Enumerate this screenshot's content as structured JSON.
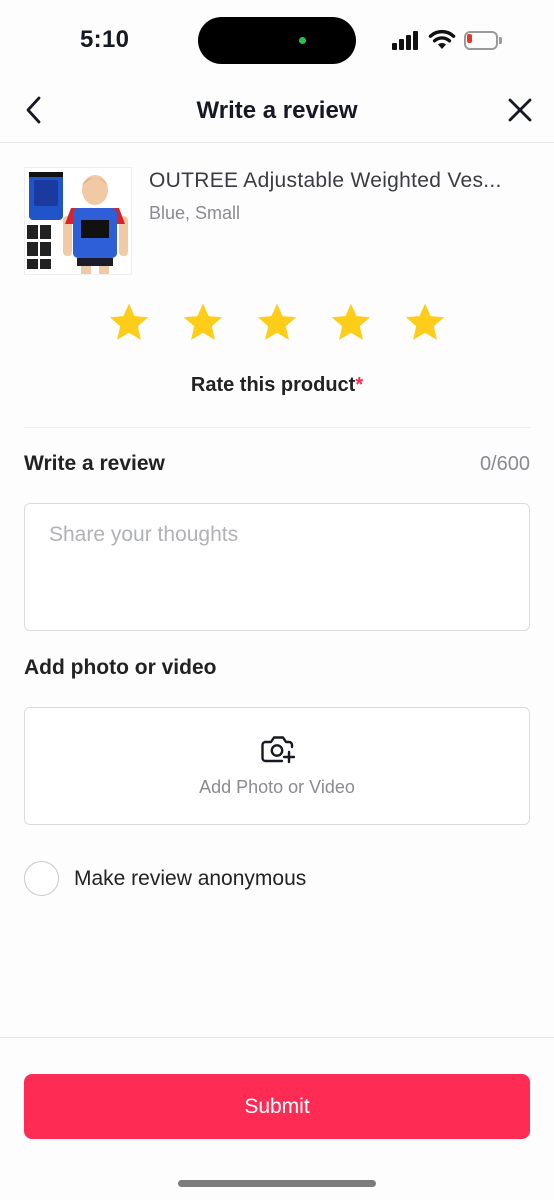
{
  "status_bar": {
    "time": "5:10",
    "icons": [
      "signal-icon",
      "wifi-icon",
      "battery-low-icon"
    ],
    "battery_color": "#e5372c"
  },
  "header": {
    "title": "Write a review",
    "back_icon": "chevron-left-icon",
    "close_icon": "close-icon"
  },
  "product": {
    "name": "OUTREE Adjustable Weighted Ves...",
    "variant": "Blue, Small",
    "image_icon": "product-thumbnail"
  },
  "rating": {
    "stars_filled": 5,
    "stars_total": 5,
    "label": "Rate this product",
    "required_mark": "*",
    "star_color": "#fdcd19"
  },
  "review": {
    "heading": "Write a review",
    "char_count": "0/600",
    "placeholder": "Share your thoughts",
    "value": ""
  },
  "media": {
    "heading": "Add photo or video",
    "button_label": "Add Photo or Video",
    "icon": "camera-plus-icon"
  },
  "anonymous": {
    "label": "Make review anonymous",
    "checked": false
  },
  "submit": {
    "label": "Submit",
    "color": "#fe2c55"
  }
}
